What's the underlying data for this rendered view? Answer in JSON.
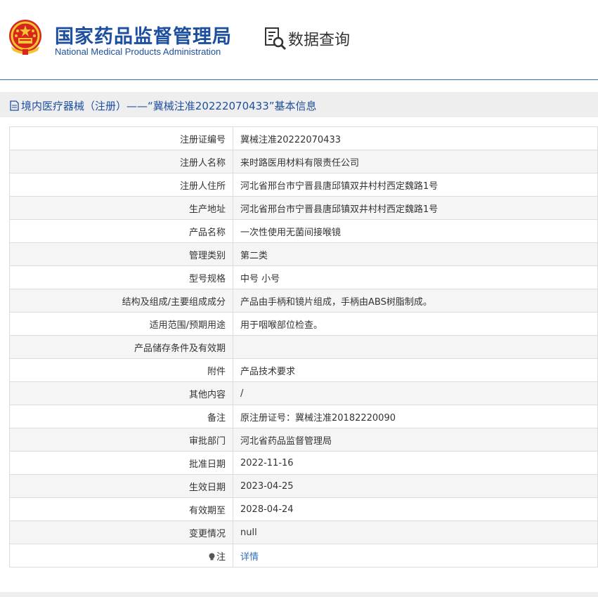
{
  "header": {
    "org_cn": "国家药品监督管理局",
    "org_en": "National Medical Products Administration",
    "query_label": "数据查询"
  },
  "subtitle": "境内医疗器械（注册）——“冀械注准20222070433”基本信息",
  "rows": [
    {
      "label": "注册证编号",
      "value": "冀械注准20222070433"
    },
    {
      "label": "注册人名称",
      "value": "来时路医用材料有限责任公司"
    },
    {
      "label": "注册人住所",
      "value": "河北省邢台市宁晋县唐邱镇双井村村西定魏路1号"
    },
    {
      "label": "生产地址",
      "value": "河北省邢台市宁晋县唐邱镇双井村村西定魏路1号"
    },
    {
      "label": "产品名称",
      "value": "一次性使用无菌间接喉镜"
    },
    {
      "label": "管理类别",
      "value": "第二类"
    },
    {
      "label": "型号规格",
      "value": "中号 小号"
    },
    {
      "label": "结构及组成/主要组成成分",
      "value": "产品由手柄和镜片组成，手柄由ABS树脂制成。"
    },
    {
      "label": "适用范围/预期用途",
      "value": "用于咽喉部位检查。"
    },
    {
      "label": "产品储存条件及有效期",
      "value": ""
    },
    {
      "label": "附件",
      "value": "产品技术要求"
    },
    {
      "label": "其他内容",
      "value": "/"
    },
    {
      "label": "备注",
      "value": "原注册证号：冀械注准20182220090"
    },
    {
      "label": "审批部门",
      "value": "河北省药品监督管理局"
    },
    {
      "label": "批准日期",
      "value": "2022-11-16"
    },
    {
      "label": "生效日期",
      "value": "2023-04-25"
    },
    {
      "label": "有效期至",
      "value": "2028-04-24"
    },
    {
      "label": "变更情况",
      "value": "null"
    }
  ],
  "note": {
    "label": "注",
    "link": "详情"
  },
  "colors": {
    "brand": "#1d4fa0",
    "link": "#2f6fba",
    "row_alt": "#f5f5f5",
    "border": "#dcdcdc"
  }
}
